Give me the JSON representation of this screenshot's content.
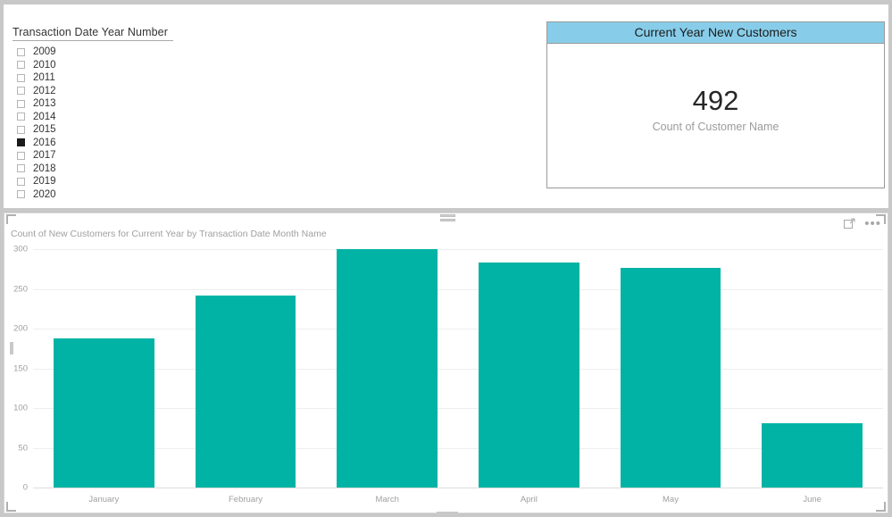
{
  "slicer": {
    "title": "Transaction Date Year Number",
    "items": [
      {
        "label": "2009",
        "checked": false
      },
      {
        "label": "2010",
        "checked": false
      },
      {
        "label": "2011",
        "checked": false
      },
      {
        "label": "2012",
        "checked": false
      },
      {
        "label": "2013",
        "checked": false
      },
      {
        "label": "2014",
        "checked": false
      },
      {
        "label": "2015",
        "checked": false
      },
      {
        "label": "2016",
        "checked": true
      },
      {
        "label": "2017",
        "checked": false
      },
      {
        "label": "2018",
        "checked": false
      },
      {
        "label": "2019",
        "checked": false
      },
      {
        "label": "2020",
        "checked": false
      }
    ]
  },
  "card": {
    "title": "Current Year New Customers",
    "value": "492",
    "label": "Count of Customer Name",
    "title_bar_color": "#87cdea"
  },
  "chart_visual": {
    "focus_icon": "focus-mode-icon",
    "more_icon": "•••",
    "drag_handle": "resize-handle"
  },
  "chart_data": {
    "type": "bar",
    "title": "Count of New Customers for Current Year by Transaction Date Month Name",
    "xlabel": "",
    "ylabel": "",
    "categories": [
      "January",
      "February",
      "March",
      "April",
      "May",
      "June"
    ],
    "values": [
      188,
      242,
      300,
      283,
      276,
      81
    ],
    "ylim": [
      0,
      300
    ],
    "yticks": [
      300,
      250,
      200,
      150,
      100,
      50,
      0
    ],
    "grid": true,
    "legend": "none",
    "bar_color": "#00b3a4"
  }
}
